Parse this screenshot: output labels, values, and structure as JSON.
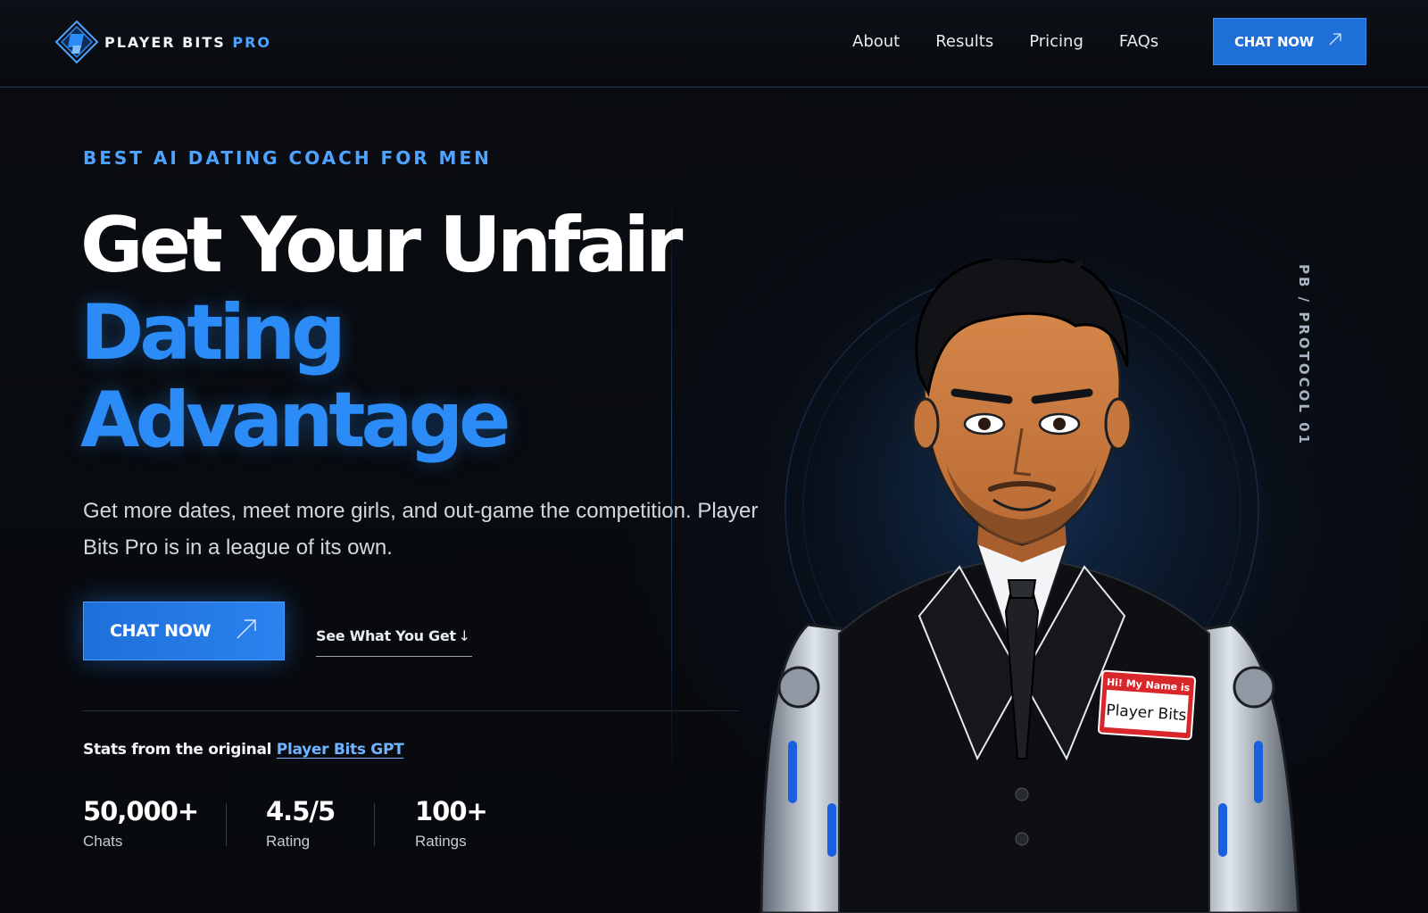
{
  "nav": {
    "brand_main": "PLAYER BITS",
    "brand_pro": "PRO",
    "links": [
      "About",
      "Results",
      "Pricing",
      "FAQs"
    ],
    "cta_label": "CHAT NOW"
  },
  "hero": {
    "eyebrow": "BEST AI DATING COACH FOR MEN",
    "headline_line1": "Get Your Unfair",
    "headline_line2": "Dating",
    "headline_line3": "Advantage",
    "subtext": "Get more dates, meet more girls, and out-game the competition. Player Bits Pro is in a league of its own.",
    "cta_primary": "CHAT NOW",
    "cta_secondary": "See What You Get",
    "stats_note_prefix": "Stats from the original",
    "stats_note_link": "Player Bits GPT",
    "stats": [
      {
        "value": "50,000+",
        "label": "Chats"
      },
      {
        "value": "4.5/5",
        "label": "Rating"
      },
      {
        "value": "100+",
        "label": "Ratings"
      }
    ]
  },
  "illustration": {
    "side_label": "PB / PROTOCOL 01",
    "name_tag_top": "Hi! My Name is",
    "name_tag_name": "Player Bits"
  },
  "colors": {
    "accent": "#2b8cf7",
    "button": "#1f6fd9",
    "background": "#07090d"
  },
  "icons": [
    "brand-logo-icon",
    "arrow-up-right-icon",
    "arrow-down-icon"
  ]
}
